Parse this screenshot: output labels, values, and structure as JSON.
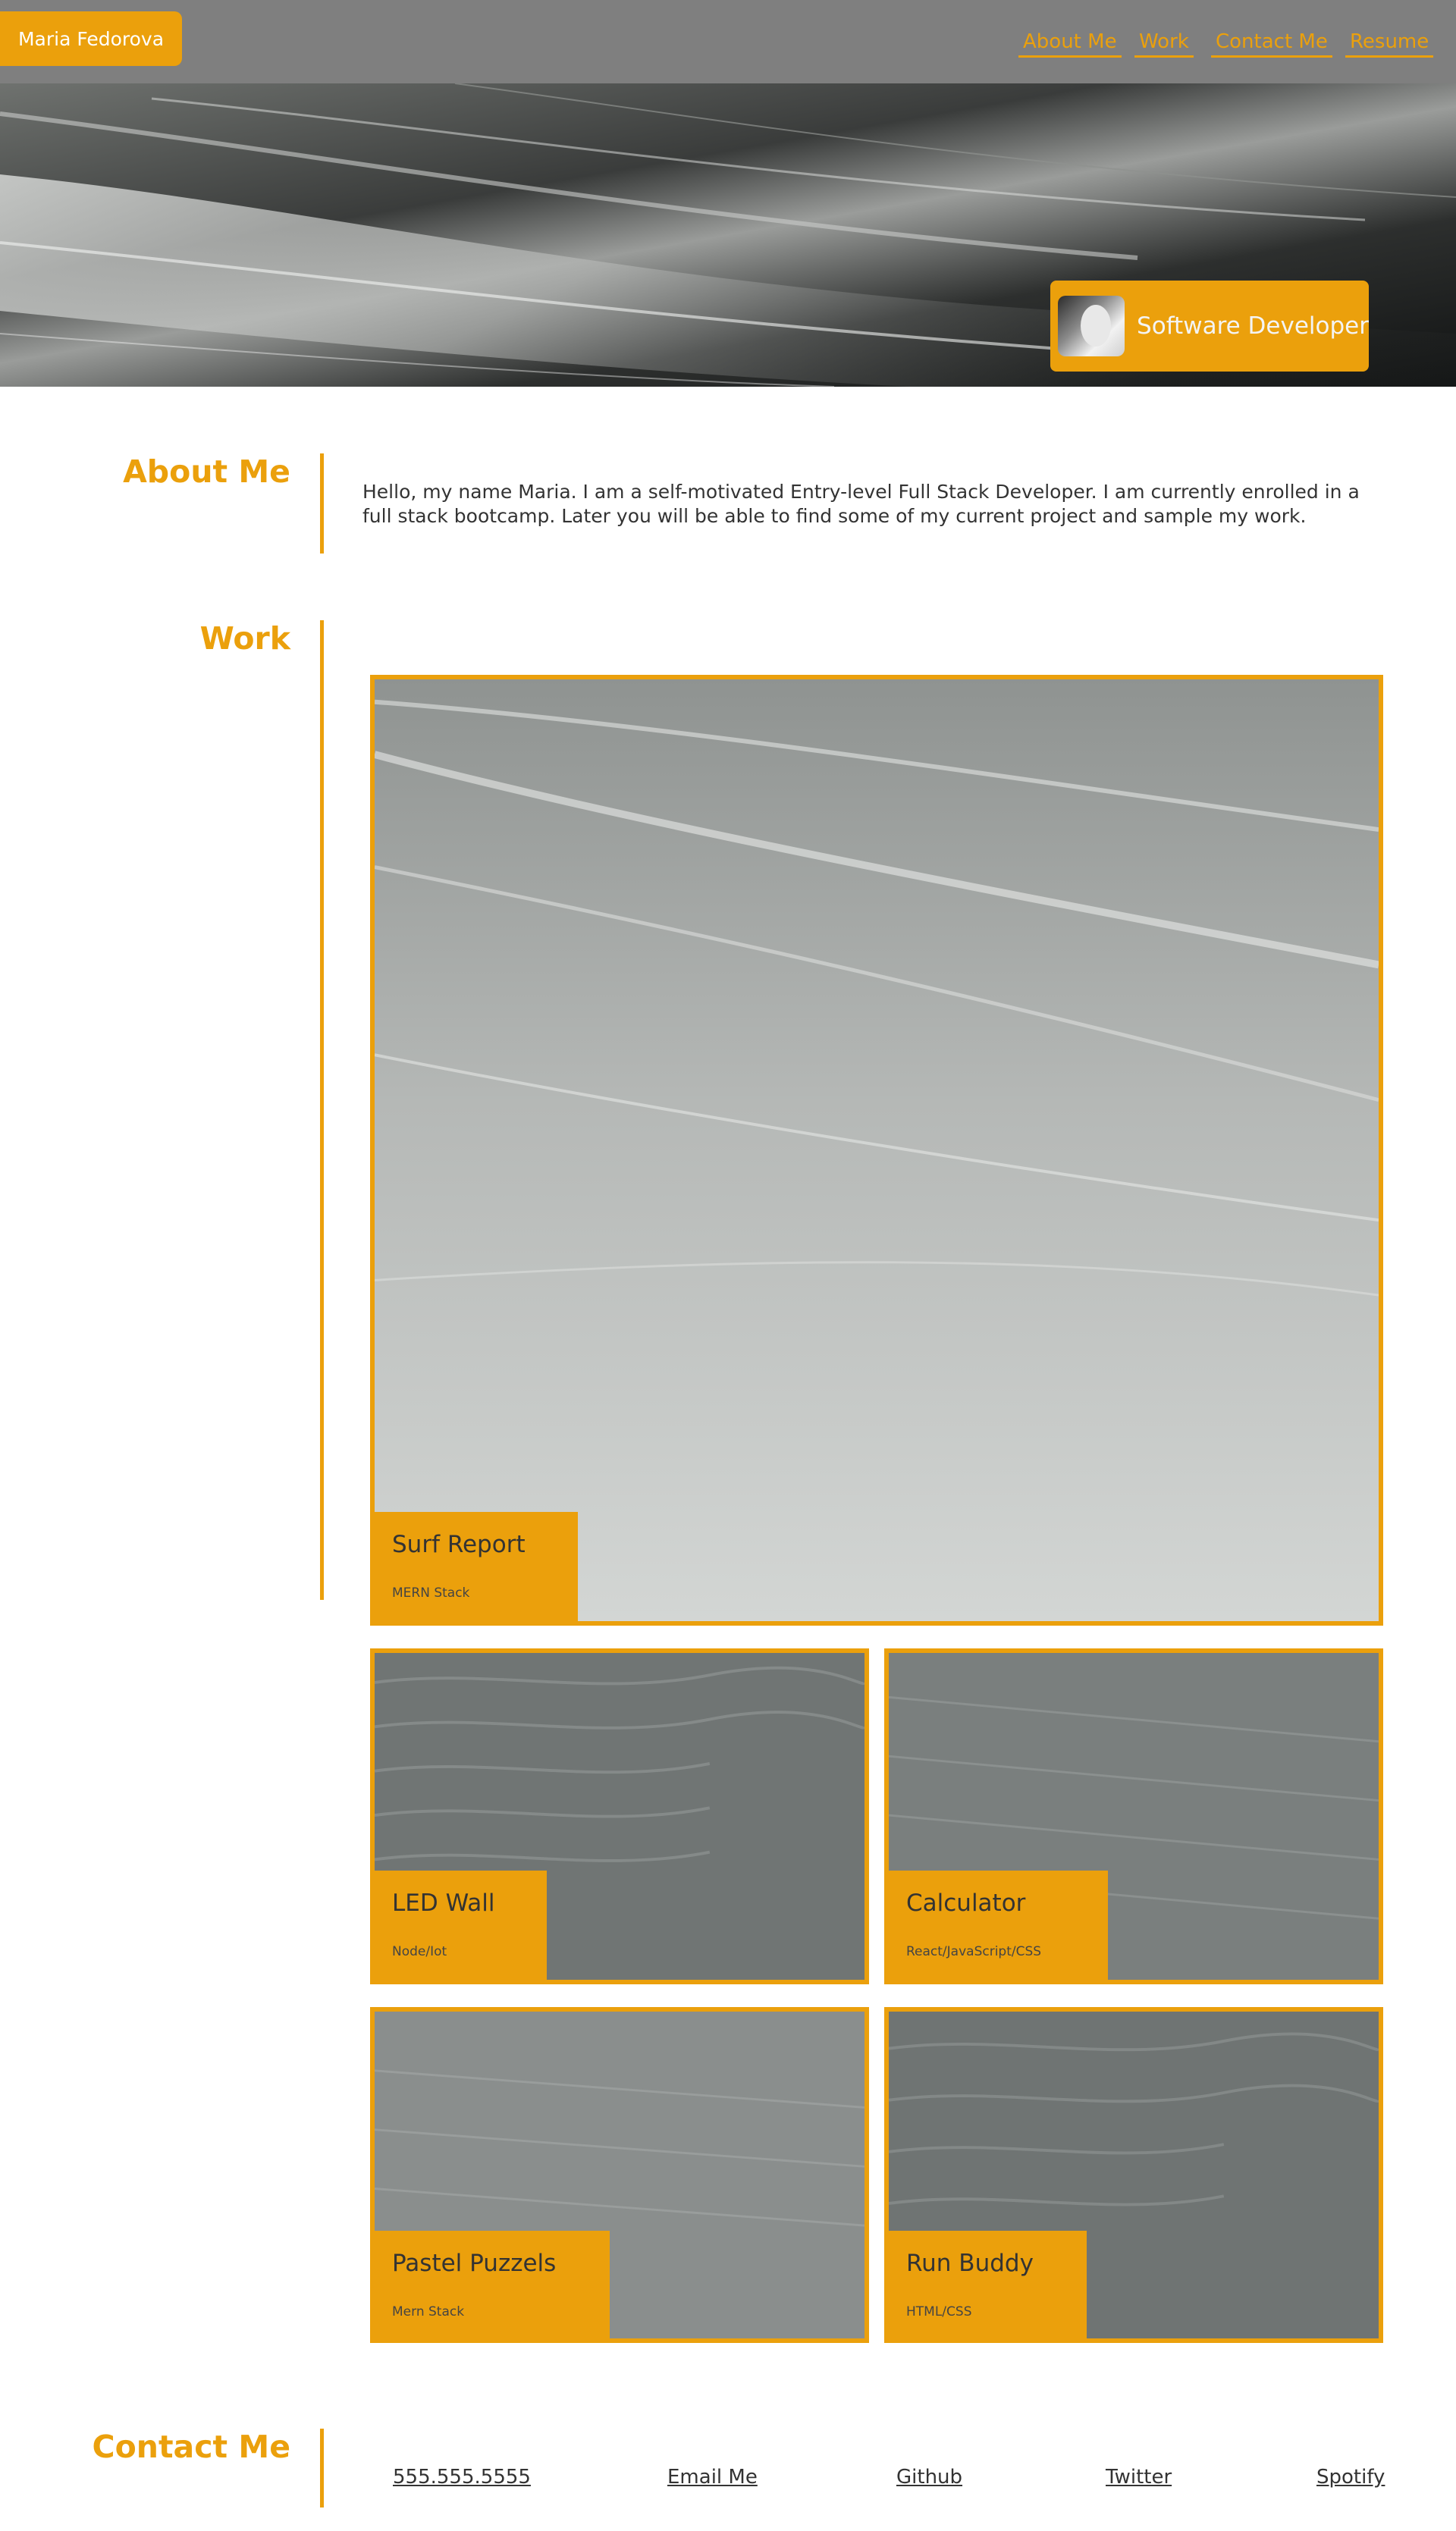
{
  "header": {
    "name": "Maria Fedorova",
    "nav": [
      "About Me",
      "Work",
      "Contact Me",
      "Resume"
    ]
  },
  "hero": {
    "role": "Software Developer"
  },
  "about": {
    "title": "About Me",
    "text": "Hello, my name Maria. I am a self-motivated Entry-level Full Stack Developer. I am currently enrolled in a full stack bootcamp. Later you will be able to find some of my current project and sample my work."
  },
  "work": {
    "title": "Work",
    "projects": [
      {
        "title": "Surf Report",
        "stack": "MERN Stack"
      },
      {
        "title": "LED Wall",
        "stack": "Node/Iot"
      },
      {
        "title": "Calculator",
        "stack": "React/JavaScript/CSS"
      },
      {
        "title": "Pastel Puzzels",
        "stack": "Mern Stack"
      },
      {
        "title": "Run Buddy",
        "stack": "HTML/CSS"
      }
    ]
  },
  "contact": {
    "title": "Contact Me",
    "links": [
      "555.555.5555",
      "Email Me",
      "Github",
      "Twitter",
      "Spotify"
    ]
  },
  "colors": {
    "accent": "#eba00c",
    "header_bg": "#7f7f7f",
    "text": "#333333"
  }
}
